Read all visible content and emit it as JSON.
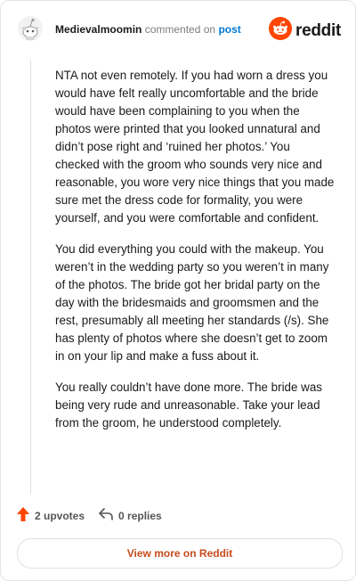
{
  "header": {
    "username": "Medievalmoomin",
    "commented_text": "commented on",
    "post_link": "post",
    "brand": "reddit"
  },
  "comment": {
    "paragraphs": [
      "NTA not even remotely. If you had worn a dress you would have felt really uncomfortable and the bride would have been complaining to you when the photos were printed that you looked unnatural and didn’t pose right and ‘ruined her photos.’ You checked with the groom who sounds very nice and reasonable, you wore very nice things that you made sure met the dress code for formality, you were yourself, and you were comfortable and confident.",
      "You did everything you could with the makeup. You weren’t in the wedding party so you weren’t in many of the photos. The bride got her bridal party on the day with the bridesmaids and groomsmen and the rest, presumably all meeting her standards (/s). She has plenty of photos where she doesn’t get to zoom in on your lip and make a fuss about it.",
      "You really couldn’t have done more. The bride was being very rude and unreasonable. Take your lead from the groom, he understood completely."
    ]
  },
  "footer": {
    "upvotes": "2 upvotes",
    "replies": "0 replies",
    "view_more": "View more on Reddit"
  },
  "colors": {
    "upvote": "#ff4500",
    "link": "#0079d3",
    "view_more_text": "#c64a1c"
  },
  "icons": {
    "avatar": "snoo-avatar-icon",
    "brand": "reddit-logo-icon",
    "upvote": "upvote-arrow-icon",
    "reply": "reply-arrow-icon"
  }
}
